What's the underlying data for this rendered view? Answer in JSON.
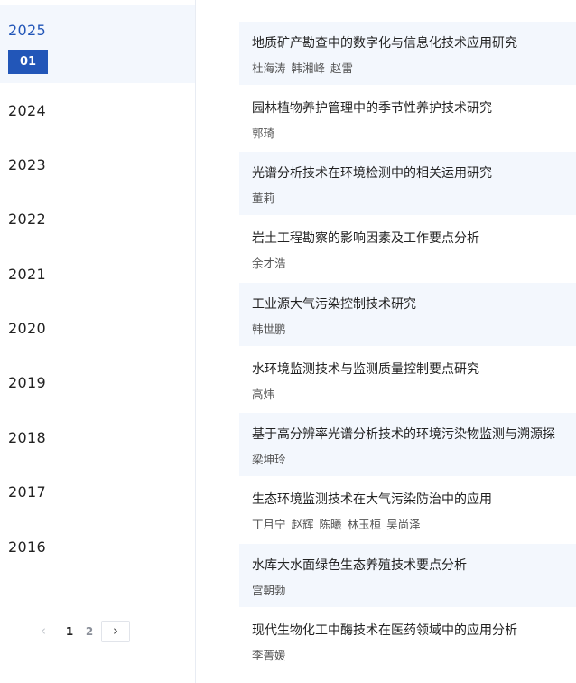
{
  "years": {
    "active_year": "2025",
    "active_issue": "01",
    "list": [
      "2024",
      "2023",
      "2022",
      "2021",
      "2020",
      "2019",
      "2018",
      "2017",
      "2016"
    ]
  },
  "pagination": {
    "prev_icon": "chevron-left-icon",
    "next_icon": "chevron-right-icon",
    "pages": [
      "1",
      "2"
    ],
    "current_page": "1"
  },
  "articles": [
    {
      "title": "地质矿产勘查中的数字化与信息化技术应用研究",
      "authors": [
        "杜海涛",
        "韩湘峰",
        "赵雷"
      ]
    },
    {
      "title": "园林植物养护管理中的季节性养护技术研究",
      "authors": [
        "郭琦"
      ]
    },
    {
      "title": "光谱分析技术在环境检测中的相关运用研究",
      "authors": [
        "董莉"
      ]
    },
    {
      "title": "岩土工程勘察的影响因素及工作要点分析",
      "authors": [
        "余才浩"
      ]
    },
    {
      "title": "工业源大气污染控制技术研究",
      "authors": [
        "韩世鹏"
      ]
    },
    {
      "title": "水环境监测技术与监测质量控制要点研究",
      "authors": [
        "高炜"
      ]
    },
    {
      "title": "基于高分辨率光谱分析技术的环境污染物监测与溯源探",
      "authors": [
        "梁坤玲"
      ]
    },
    {
      "title": "生态环境监测技术在大气污染防治中的应用",
      "authors": [
        "丁月宁",
        "赵辉",
        "陈曦",
        "林玉桓",
        "吴尚泽"
      ]
    },
    {
      "title": "水库大水面绿色生态养殖技术要点分析",
      "authors": [
        "宫朝勃"
      ]
    },
    {
      "title": "现代生物化工中酶技术在医药领域中的应用分析",
      "authors": [
        "李菁媛"
      ]
    }
  ],
  "colors": {
    "accent": "#2256b8",
    "shade": "#f3f7fd"
  }
}
